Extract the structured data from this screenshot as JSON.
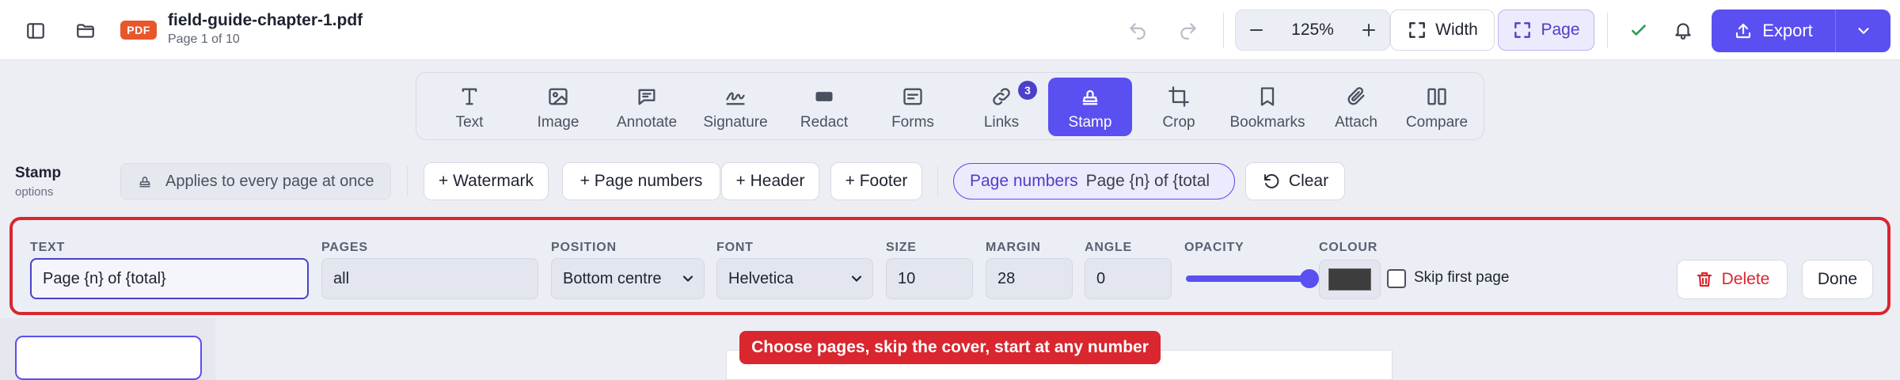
{
  "header": {
    "file_badge": "PDF",
    "file_name": "field-guide-chapter-1.pdf",
    "page_info": "Page 1 of 10",
    "zoom": "125%",
    "fit_width_label": "Width",
    "fit_page_label": "Page",
    "export_label": "Export"
  },
  "toolbar": {
    "tools": [
      {
        "label": "Text",
        "icon": "text-icon"
      },
      {
        "label": "Image",
        "icon": "image-icon"
      },
      {
        "label": "Annotate",
        "icon": "comment-icon"
      },
      {
        "label": "Signature",
        "icon": "signature-icon"
      },
      {
        "label": "Redact",
        "icon": "redact-icon"
      },
      {
        "label": "Forms",
        "icon": "form-icon"
      },
      {
        "label": "Links",
        "icon": "link-icon",
        "badge": "3"
      },
      {
        "label": "Stamp",
        "icon": "stamp-icon",
        "active": true
      },
      {
        "label": "Crop",
        "icon": "crop-icon"
      },
      {
        "label": "Bookmarks",
        "icon": "bookmark-icon"
      },
      {
        "label": "Attach",
        "icon": "paperclip-icon"
      },
      {
        "label": "Compare",
        "icon": "compare-icon"
      }
    ]
  },
  "stamp_options": {
    "title": "Stamp",
    "subtitle": "options",
    "applies_text": "Applies to every page at once",
    "add_watermark": "+ Watermark",
    "add_page_numbers": "+ Page numbers",
    "add_header": "+ Header",
    "add_footer": "+ Footer",
    "active_chip_key": "Page numbers",
    "active_chip_value": "Page {n} of {total",
    "clear_label": "Clear"
  },
  "fields": {
    "text_label": "TEXT",
    "text_value": "Page {n} of {total}",
    "pages_label": "PAGES",
    "pages_value": "all",
    "position_label": "POSITION",
    "position_value": "Bottom centre",
    "font_label": "FONT",
    "font_value": "Helvetica",
    "size_label": "SIZE",
    "size_value": "10",
    "margin_label": "MARGIN",
    "margin_value": "28",
    "angle_label": "ANGLE",
    "angle_value": "0",
    "opacity_label": "OPACITY",
    "opacity_level": 1.0,
    "colour_label": "COLOUR",
    "colour_value": "#3d3d3d",
    "skip_first_label": "Skip first page",
    "skip_first_checked": false,
    "delete_label": "Delete",
    "done_label": "Done"
  },
  "tooltip": {
    "text": "Choose pages, skip the cover, start at any number"
  },
  "colors": {
    "accent": "#5a4ff0",
    "danger": "#d9262f",
    "pdf_badge": "#e8572c",
    "success": "#2e9e4f"
  }
}
